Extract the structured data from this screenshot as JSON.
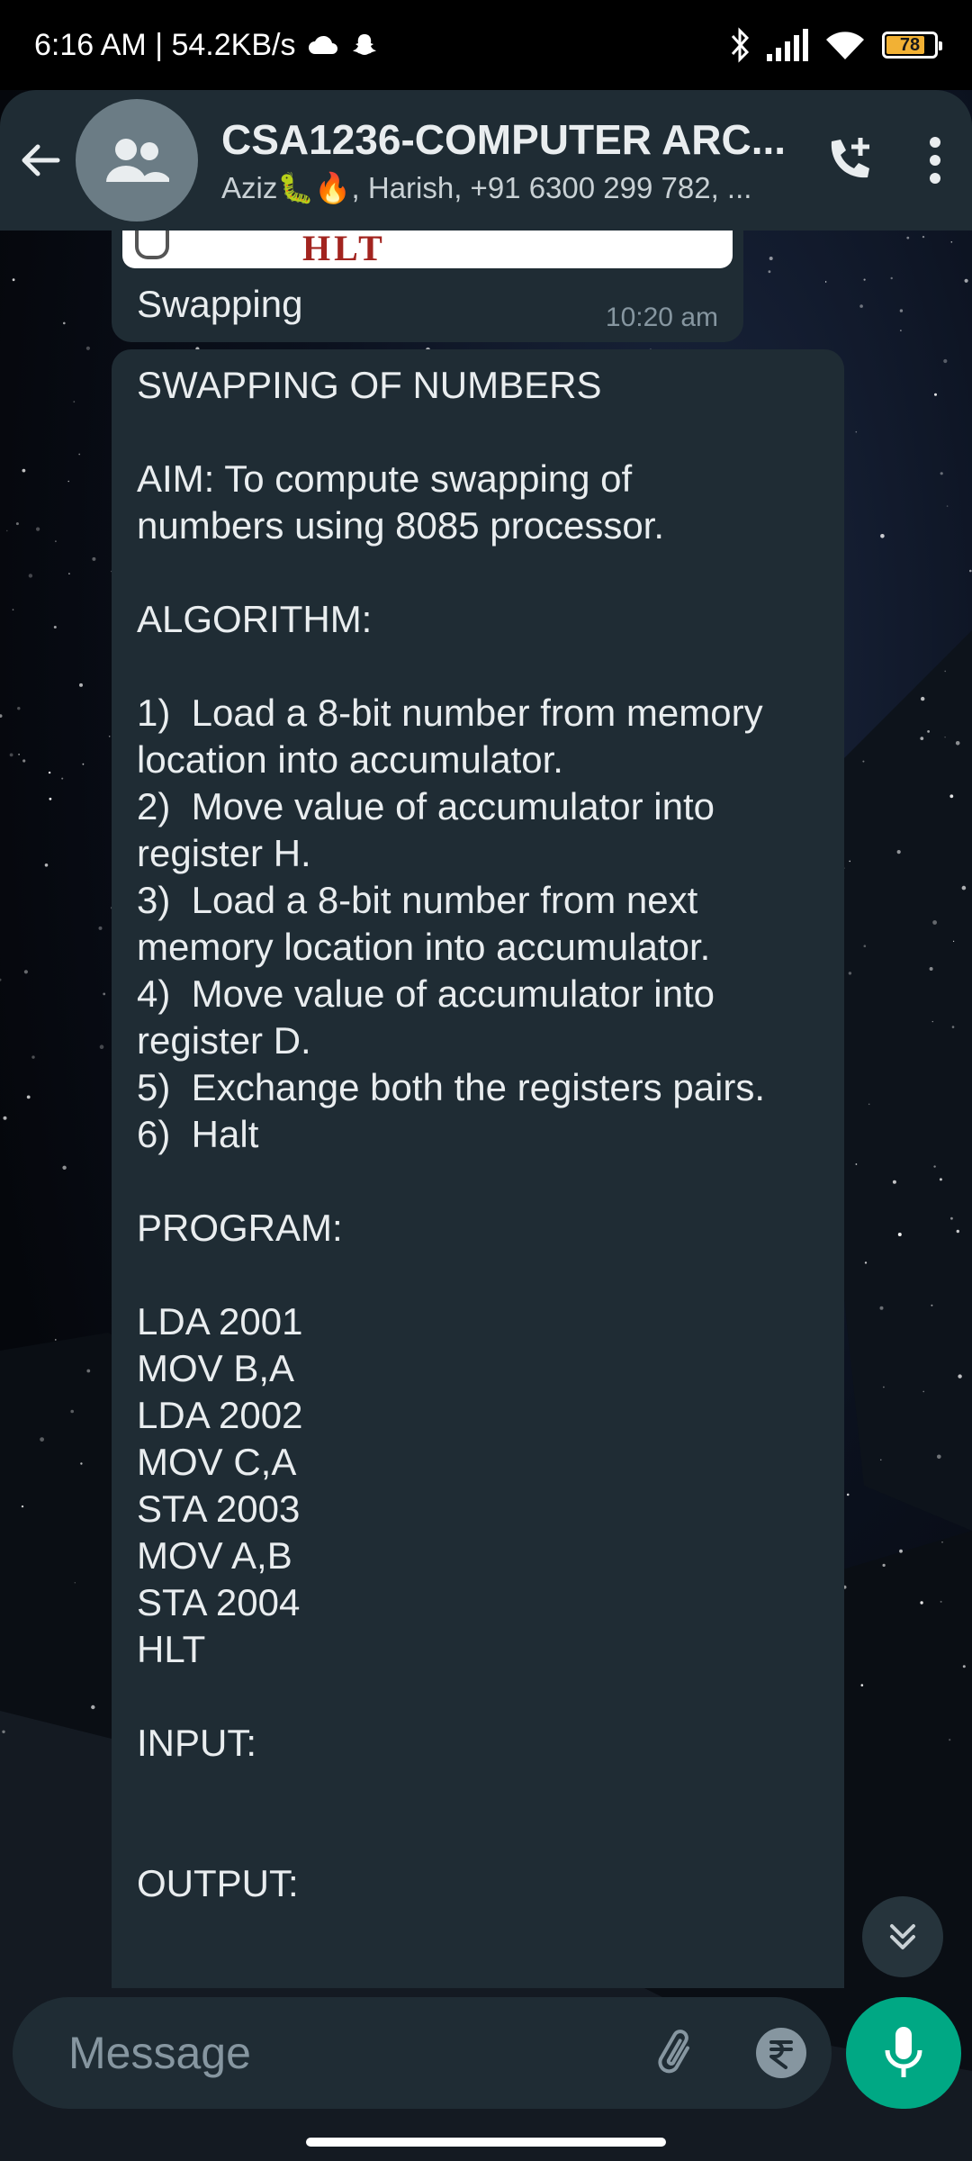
{
  "status_bar": {
    "time_speed": "6:16 AM | 54.2KB/s",
    "battery": "78"
  },
  "header": {
    "title": "CSA1236-COMPUTER ARC...",
    "participants": "Aziz🐛🔥, Harish, +91 6300 299 782, ..."
  },
  "previous_message": {
    "image_text": "HLT",
    "caption": "Swapping",
    "time": "10:20 am"
  },
  "message_lines": [
    "SWAPPING OF NUMBERS",
    "",
    "AIM: To compute swapping of",
    "numbers using 8085 processor.",
    "",
    "ALGORITHM:",
    "",
    "1)  Load a 8-bit number from memory",
    "location into accumulator.",
    "2)  Move value of accumulator into",
    "register H.",
    "3)  Load a 8-bit number from next",
    "memory location into accumulator.",
    "4)  Move value of accumulator into",
    "register D.",
    "5)  Exchange both the registers pairs.",
    "6)  Halt",
    "",
    "PROGRAM:",
    "",
    "LDA 2001",
    "MOV B,A",
    "LDA 2002",
    "MOV C,A",
    "STA 2003",
    "MOV A,B",
    "STA 2004",
    "HLT",
    "",
    "INPUT:",
    "",
    "",
    "OUTPUT:"
  ],
  "composer": {
    "placeholder": "Message"
  },
  "colors": {
    "header_bg": "#1f2c34",
    "bubble_bg": "#1f2c34",
    "accent": "#00a884",
    "secondary_text": "#8696a0"
  },
  "icons": [
    "back-arrow-icon",
    "group-avatar-icon",
    "add-call-icon",
    "more-vert-icon",
    "emoji-icon",
    "attach-icon",
    "rupee-icon",
    "camera-icon",
    "mic-icon",
    "scroll-down-icon"
  ]
}
